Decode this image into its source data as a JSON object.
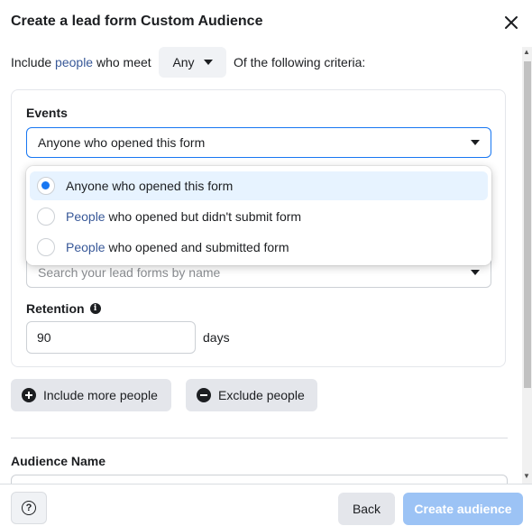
{
  "dialog": {
    "title": "Create a lead form Custom Audience"
  },
  "criteria": {
    "prefix": "Include",
    "people_link": "people",
    "middle": "who meet",
    "match_value": "Any",
    "suffix": "Of the following criteria:"
  },
  "events": {
    "label": "Events",
    "selected": "Anyone who opened this form",
    "options": [
      {
        "lead": "",
        "text": "Anyone who opened this form",
        "selected": true
      },
      {
        "lead": "People",
        "text": " who opened but didn't submit form",
        "selected": false
      },
      {
        "lead": "People",
        "text": " who opened and submitted form",
        "selected": false
      }
    ]
  },
  "lead_forms": {
    "placeholder": "Search your lead forms by name"
  },
  "retention": {
    "label": "Retention",
    "value": "90",
    "unit": "days"
  },
  "actions": {
    "include_more": "Include more people",
    "exclude": "Exclude people"
  },
  "audience_name": {
    "label": "Audience Name"
  },
  "footer": {
    "help_glyph": "?",
    "back": "Back",
    "create": "Create audience"
  },
  "colors": {
    "accent": "#1877f2",
    "link": "#385898",
    "create_disabled": "#9cc3f5"
  }
}
